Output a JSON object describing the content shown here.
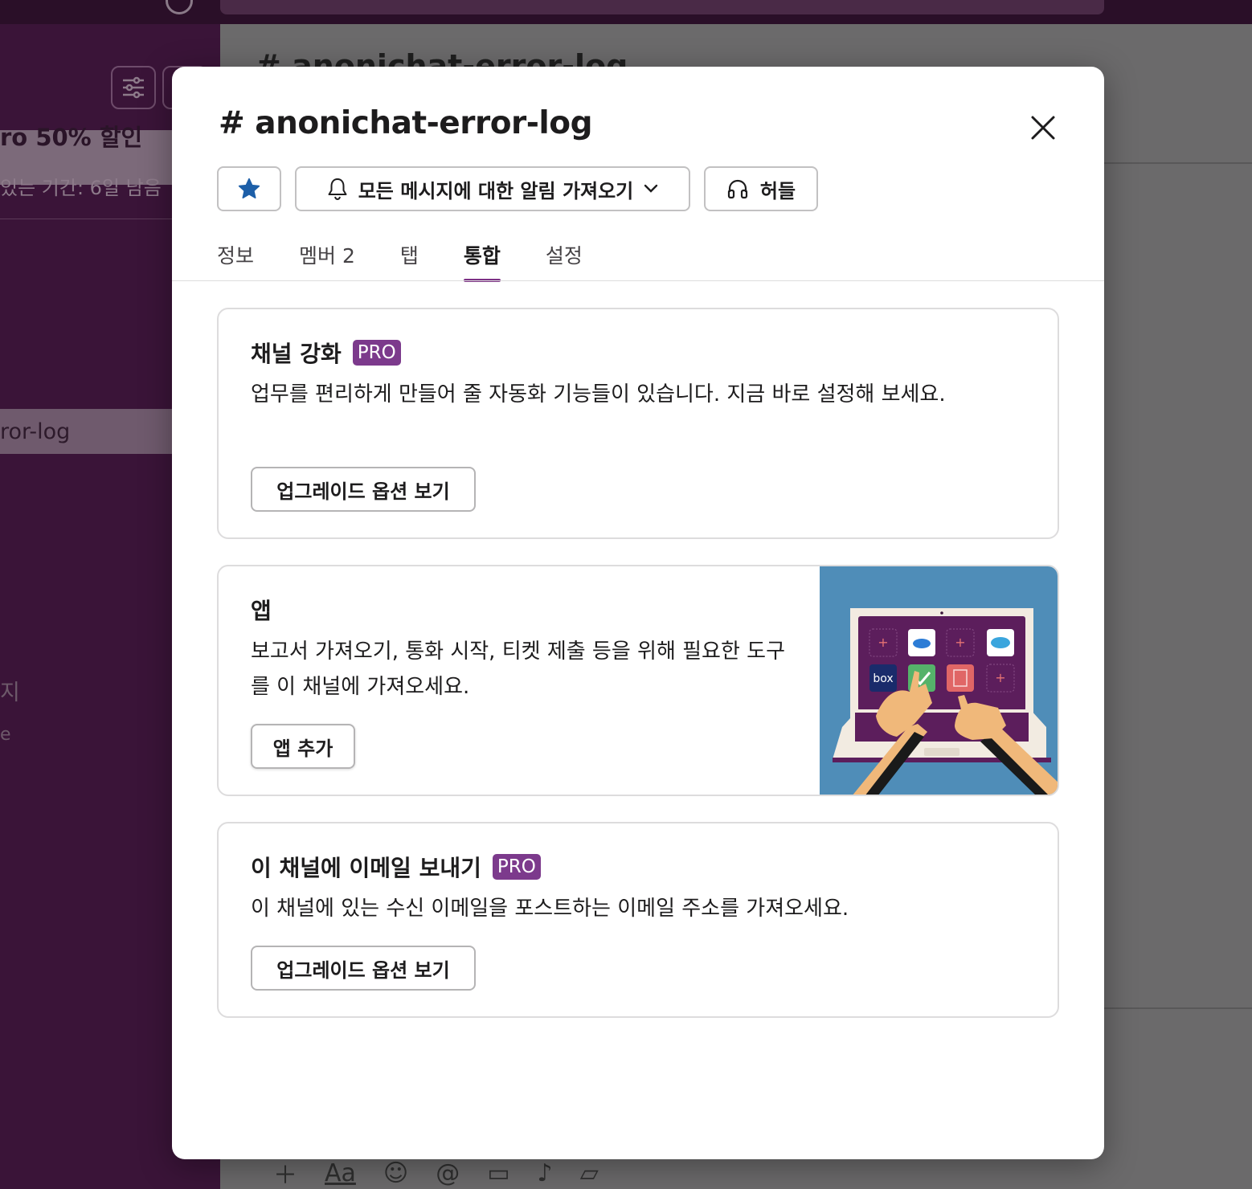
{
  "background": {
    "sidebar": {
      "promo_text": "ro 50% 할인",
      "trial_text": "있는 기간: 6일 남음",
      "active_channel": "ror-log",
      "misc_1": "지",
      "misc_2": "e"
    },
    "channel_header_title": "# anonichat-error-log"
  },
  "modal": {
    "title": "# anonichat-error-log",
    "actions": {
      "star_icon": "star-icon",
      "notify_label": "모든 메시지에 대한 알림 가져오기",
      "huddle_label": "허들"
    },
    "tabs": [
      {
        "label": "정보",
        "active": false
      },
      {
        "label": "멤버 2",
        "active": false
      },
      {
        "label": "탭",
        "active": false
      },
      {
        "label": "통합",
        "active": true
      },
      {
        "label": "설정",
        "active": false
      }
    ],
    "cards": {
      "channel_boost": {
        "title": "채널 강화",
        "badge": "PRO",
        "description": "업무를 편리하게 만들어 줄 자동화 기능들이 있습니다. 지금 바로 설정해 보세요.",
        "button": "업그레이드 옵션 보기"
      },
      "apps": {
        "title": "앱",
        "description": "보고서 가져오기, 통화 시작, 티켓 제출 등을 위해 필요한 도구를 이 채널에 가져오세요.",
        "button": "앱 추가",
        "illustration_box_label": "box"
      },
      "email": {
        "title": "이 채널에 이메일 보내기",
        "badge": "PRO",
        "description": "이 채널에 있는 수신 이메일을 포스트하는 이메일 주소를 가져오세요.",
        "button": "업그레이드 옵션 보기"
      }
    }
  },
  "colors": {
    "accent": "#7c3085",
    "pro_badge": "#7c3a8c",
    "star": "#1d5fa8",
    "illustration_bg": "#4f8db8"
  }
}
